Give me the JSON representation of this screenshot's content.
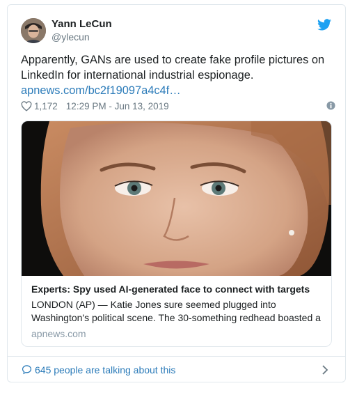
{
  "author": {
    "name": "Yann LeCun",
    "handle": "@ylecun"
  },
  "tweet": {
    "text": "Apparently, GANs are used to create fake profile pictures on LinkedIn for international industrial espionage.",
    "link": "apnews.com/bc2f19097a4c4f…",
    "likes": "1,172",
    "timestamp": "12:29 PM - Jun 13, 2019"
  },
  "link_card": {
    "title": "Experts: Spy used AI-generated face to connect with targets",
    "description": "LONDON (AP) — Katie Jones sure seemed plugged into Washington's political scene. The 30-something redhead boasted a",
    "domain": "apnews.com"
  },
  "footer": {
    "text": "645 people are talking about this"
  },
  "icons": {
    "brand": "twitter-bird-icon",
    "like": "heart-icon",
    "info": "info-icon",
    "comment": "comment-icon",
    "chevron": "chevron-right-icon"
  },
  "colors": {
    "brand_blue": "#1da1f2",
    "link_blue": "#2b7bb9",
    "secondary_text": "#697882",
    "border": "#e1e8ed"
  }
}
